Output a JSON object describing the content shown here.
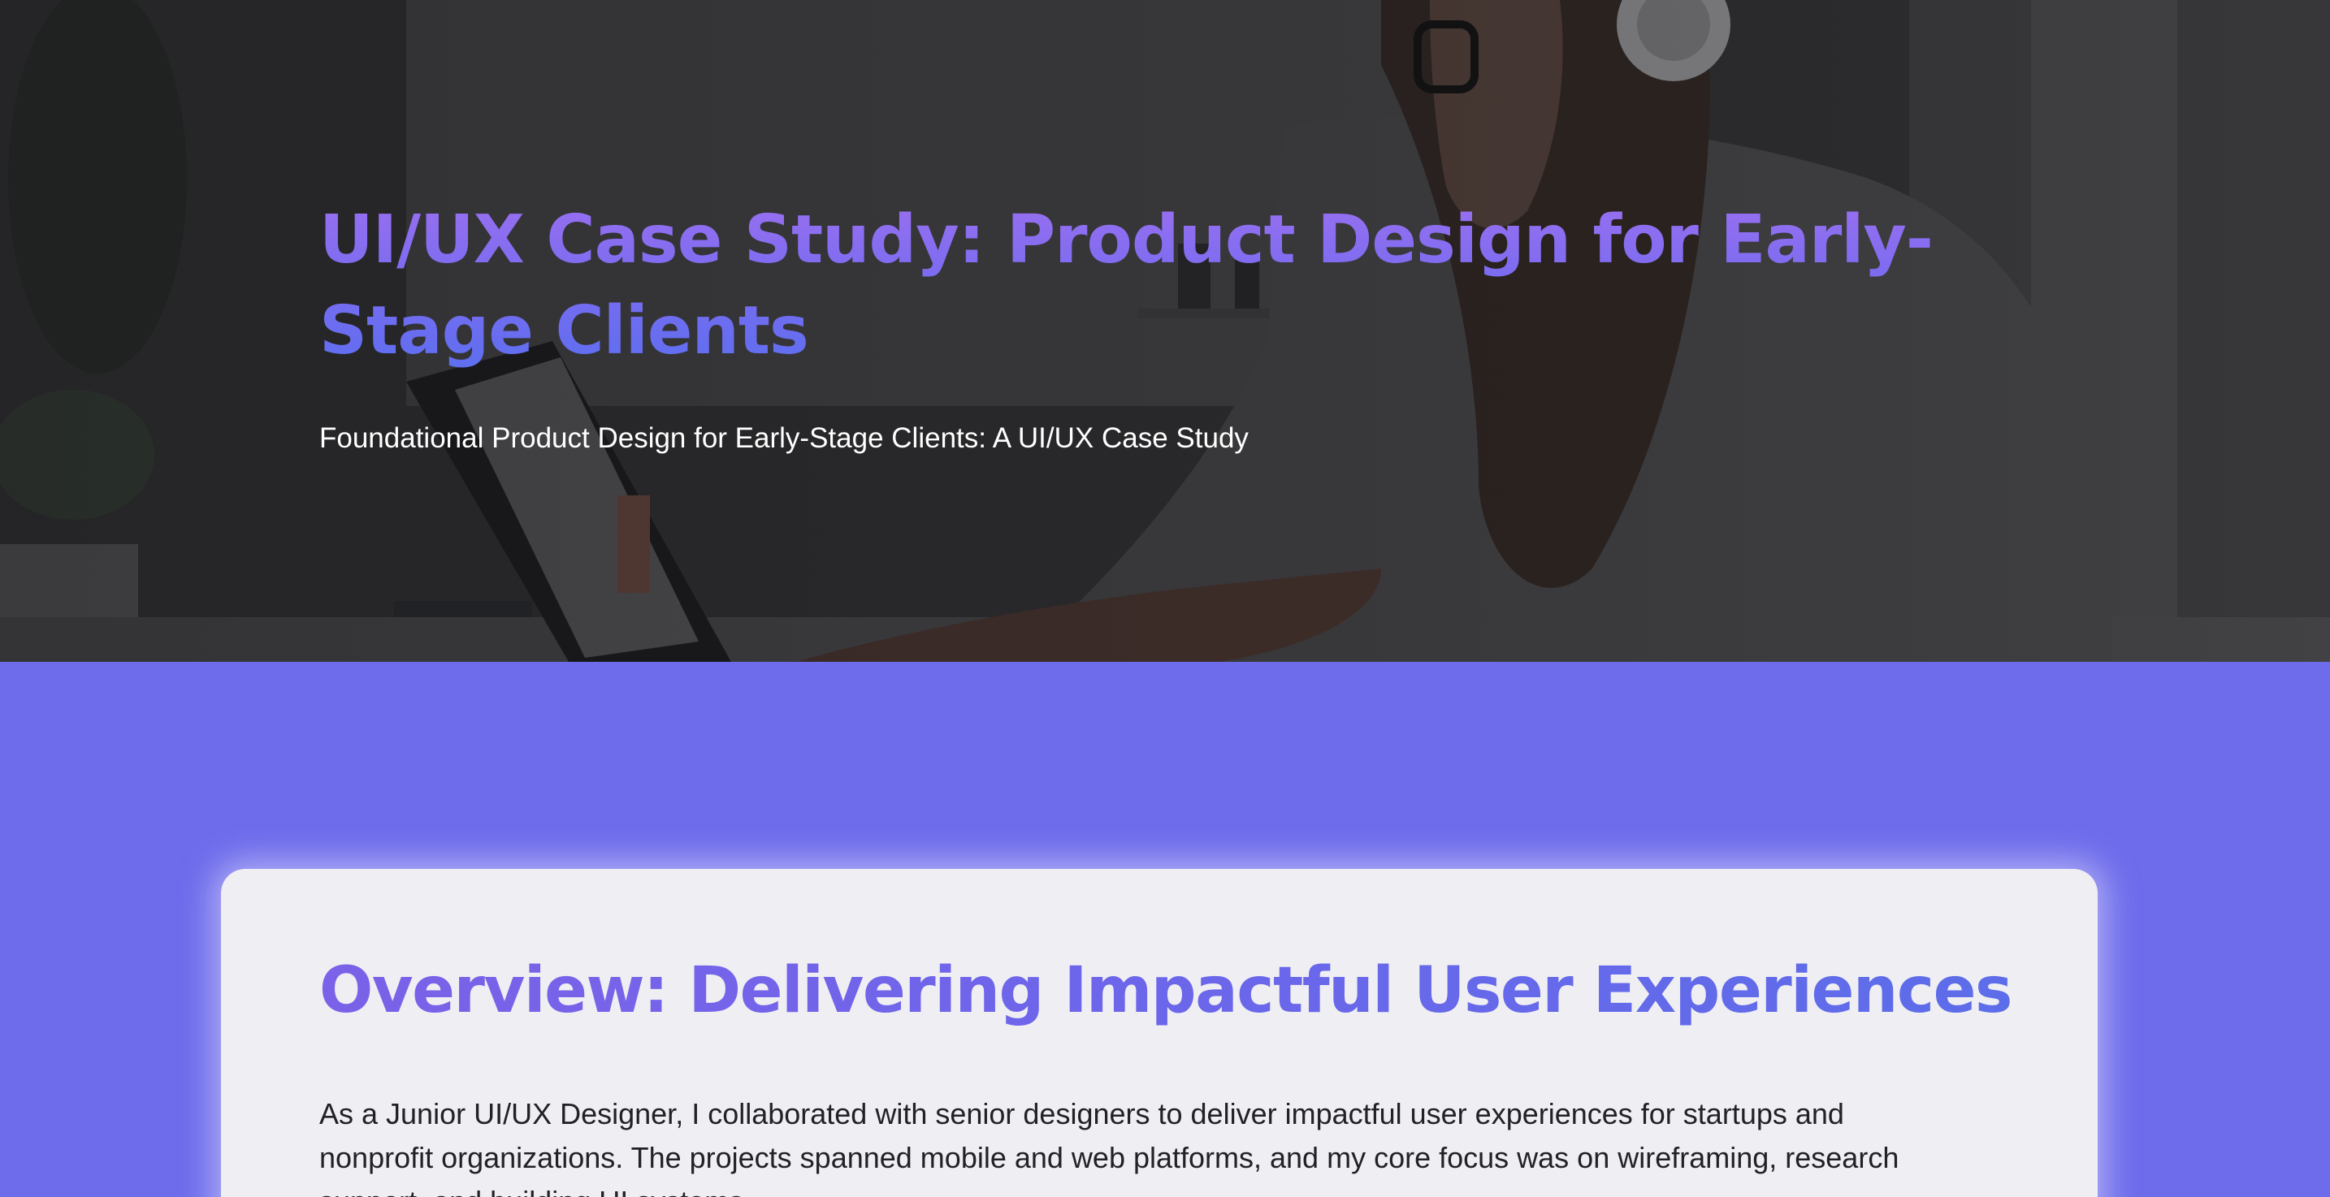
{
  "hero": {
    "title": "UI/UX Case Study: Product Design for Early-Stage Clients",
    "subtitle": "Foundational Product Design for Early-Stage Clients: A UI/UX Case Study",
    "image_subject": "woman-with-headphones-working-on-laptop"
  },
  "overview": {
    "title": "Overview: Delivering Impactful User Experiences",
    "body": "As a Junior UI/UX Designer, I collaborated with senior designers to deliver impactful user experiences for startups and nonprofit organizations. The projects spanned mobile and web platforms, and my core focus was on wireframing, research support, and building UI systems."
  },
  "colors": {
    "page_background": "#6e6ceb",
    "card_background": "#efeff3",
    "title_gradient_start": "#9b6ff0",
    "title_gradient_end": "#5c6ef0",
    "body_text": "#222226",
    "hero_subtitle": "#ffffff"
  }
}
